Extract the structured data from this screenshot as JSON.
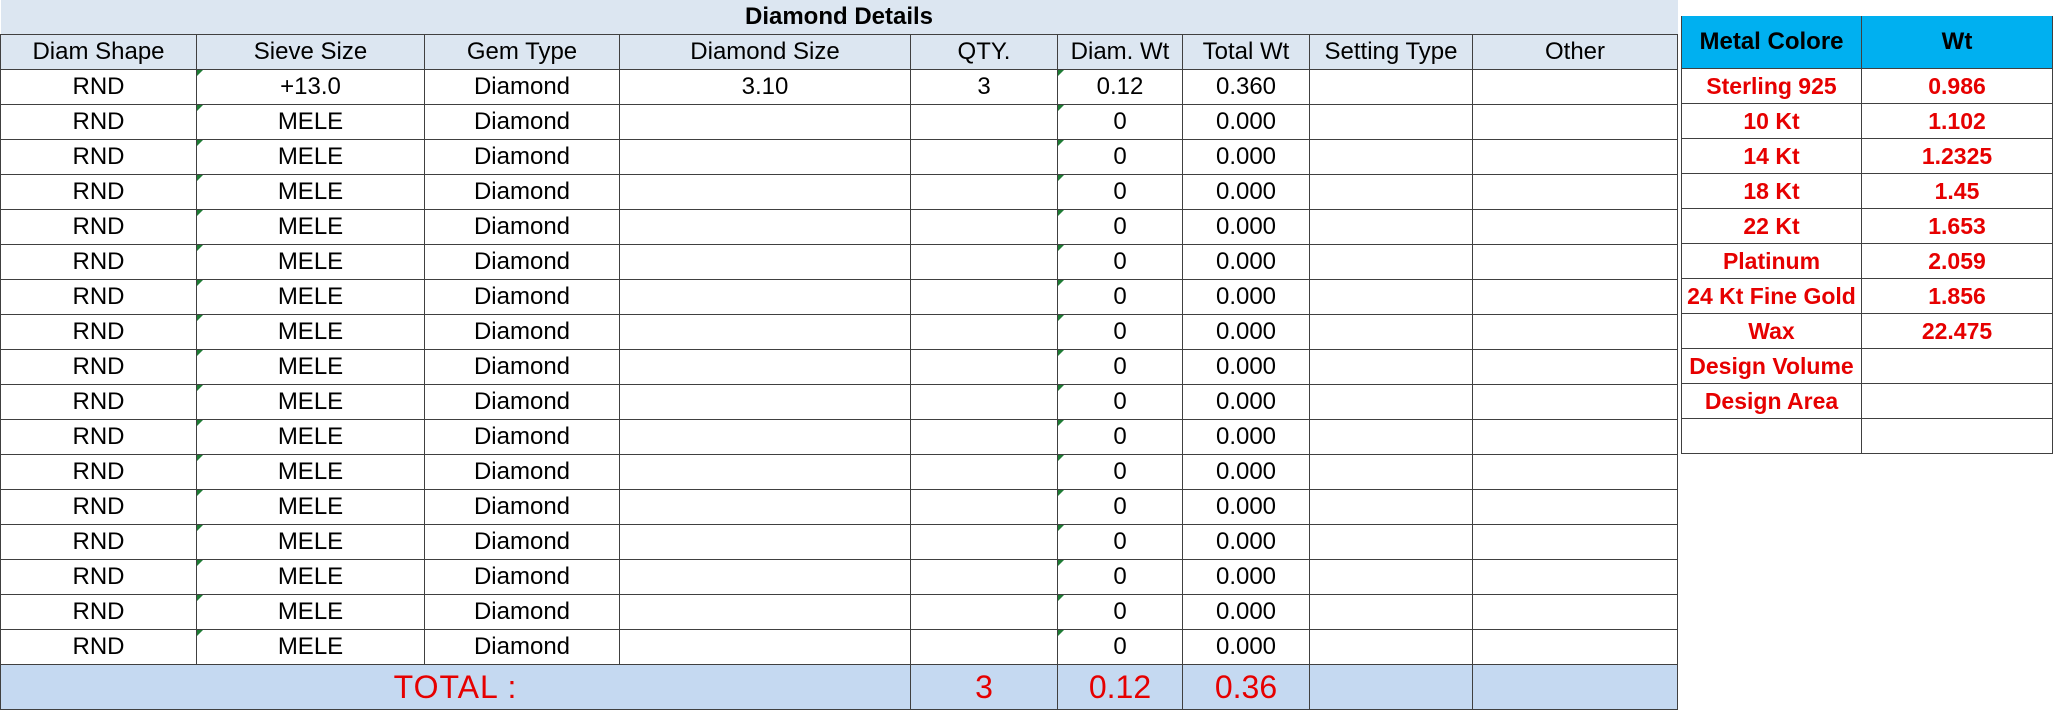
{
  "diamond_details": {
    "title": "Diamond Details",
    "columns": [
      "Diam Shape",
      "Sieve Size",
      "Gem Type",
      "Diamond Size",
      "QTY.",
      "Diam. Wt",
      "Total Wt",
      "Setting Type",
      "Other"
    ],
    "rows": [
      [
        "RND",
        "+13.0",
        "Diamond",
        "3.10",
        "3",
        "0.12",
        "0.360",
        "",
        ""
      ],
      [
        "RND",
        "MELE",
        "Diamond",
        "",
        "",
        "0",
        "0.000",
        "",
        ""
      ],
      [
        "RND",
        "MELE",
        "Diamond",
        "",
        "",
        "0",
        "0.000",
        "",
        ""
      ],
      [
        "RND",
        "MELE",
        "Diamond",
        "",
        "",
        "0",
        "0.000",
        "",
        ""
      ],
      [
        "RND",
        "MELE",
        "Diamond",
        "",
        "",
        "0",
        "0.000",
        "",
        ""
      ],
      [
        "RND",
        "MELE",
        "Diamond",
        "",
        "",
        "0",
        "0.000",
        "",
        ""
      ],
      [
        "RND",
        "MELE",
        "Diamond",
        "",
        "",
        "0",
        "0.000",
        "",
        ""
      ],
      [
        "RND",
        "MELE",
        "Diamond",
        "",
        "",
        "0",
        "0.000",
        "",
        ""
      ],
      [
        "RND",
        "MELE",
        "Diamond",
        "",
        "",
        "0",
        "0.000",
        "",
        ""
      ],
      [
        "RND",
        "MELE",
        "Diamond",
        "",
        "",
        "0",
        "0.000",
        "",
        ""
      ],
      [
        "RND",
        "MELE",
        "Diamond",
        "",
        "",
        "0",
        "0.000",
        "",
        ""
      ],
      [
        "RND",
        "MELE",
        "Diamond",
        "",
        "",
        "0",
        "0.000",
        "",
        ""
      ],
      [
        "RND",
        "MELE",
        "Diamond",
        "",
        "",
        "0",
        "0.000",
        "",
        ""
      ],
      [
        "RND",
        "MELE",
        "Diamond",
        "",
        "",
        "0",
        "0.000",
        "",
        ""
      ],
      [
        "RND",
        "MELE",
        "Diamond",
        "",
        "",
        "0",
        "0.000",
        "",
        ""
      ],
      [
        "RND",
        "MELE",
        "Diamond",
        "",
        "",
        "0",
        "0.000",
        "",
        ""
      ],
      [
        "RND",
        "MELE",
        "Diamond",
        "",
        "",
        "0",
        "0.000",
        "",
        ""
      ]
    ],
    "total": {
      "label": "TOTAL :",
      "qty": "3",
      "diam_wt": "0.12",
      "total_wt": "0.36"
    }
  },
  "metal_table": {
    "headers": [
      "Metal Colore",
      "Wt"
    ],
    "rows": [
      [
        "Sterling 925",
        "0.986"
      ],
      [
        "10 Kt",
        "1.102"
      ],
      [
        "14 Kt",
        "1.2325"
      ],
      [
        "18 Kt",
        "1.45"
      ],
      [
        "22 Kt",
        "1.653"
      ],
      [
        "Platinum",
        "2.059"
      ],
      [
        "24 Kt Fine Gold",
        "1.856"
      ],
      [
        "Wax",
        "22.475"
      ],
      [
        "Design Volume",
        ""
      ],
      [
        "Design Area",
        ""
      ],
      [
        "",
        ""
      ]
    ]
  },
  "colors": {
    "header_fill": "#dce6f1",
    "total_fill": "#c5d9f1",
    "metal_header_fill": "#00b0f0",
    "highlight_text": "#e60000"
  }
}
